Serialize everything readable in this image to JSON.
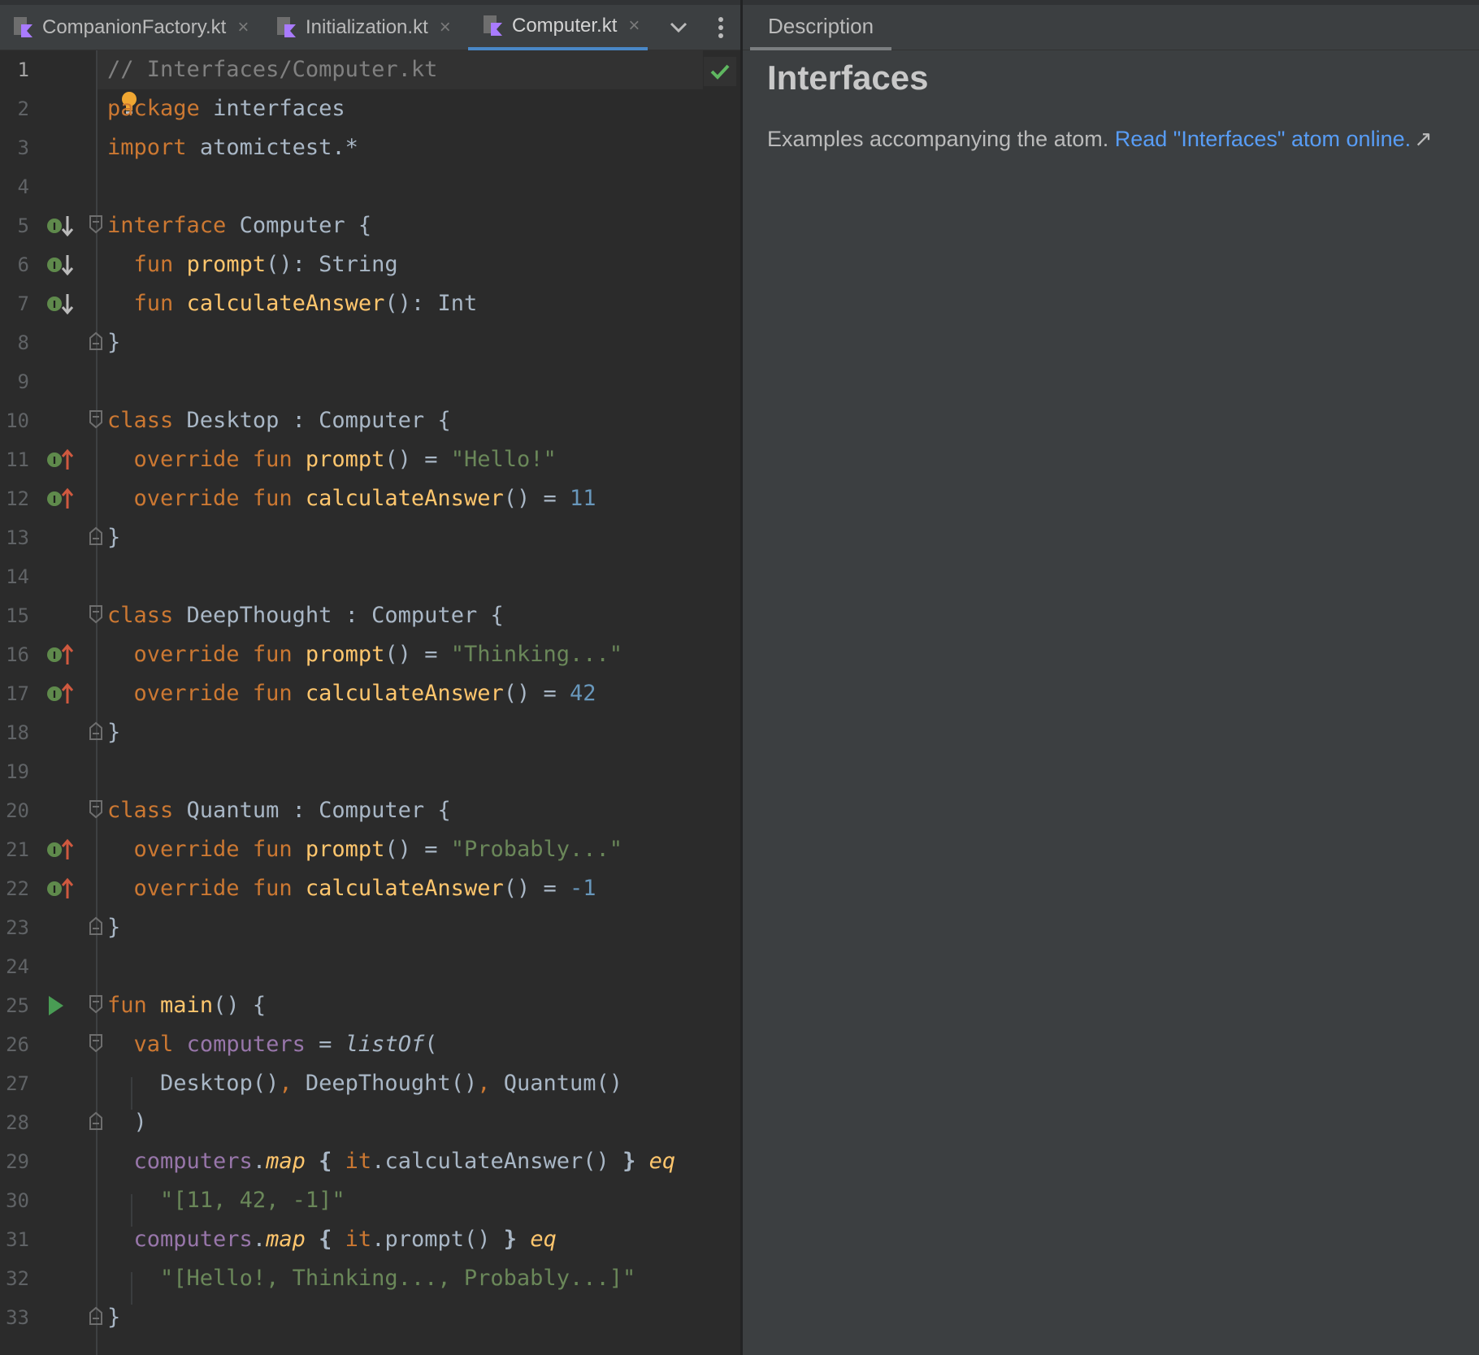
{
  "editor": {
    "tabs": [
      {
        "label": "CompanionFactory.kt",
        "close": "×"
      },
      {
        "label": "Initialization.kt",
        "close": "×"
      },
      {
        "label": "Computer.kt",
        "close": "×"
      }
    ],
    "line_numbers": [
      "1",
      "2",
      "3",
      "4",
      "5",
      "6",
      "7",
      "8",
      "9",
      "10",
      "11",
      "12",
      "13",
      "14",
      "15",
      "16",
      "17",
      "18",
      "19",
      "20",
      "21",
      "22",
      "23",
      "24",
      "25",
      "26",
      "27",
      "28",
      "29",
      "30",
      "31",
      "32",
      "33"
    ],
    "code": {
      "comment": "// Interfaces/Computer.kt",
      "kw_package": "package",
      "pkg_name": "interfaces",
      "kw_import": "import",
      "import_name": "atomictest.*",
      "kw_interface": "interface",
      "computer": "Computer",
      "brace_open": "{",
      "brace_close": "}",
      "kw_fun": "fun",
      "prompt": "prompt",
      "calculate_answer": "calculateAnswer",
      "parens_colon": "():",
      "parens": "()",
      "type_string": "String",
      "type_int": "Int",
      "kw_class": "class",
      "desktop": "Desktop",
      "deep_thought": "DeepThought",
      "quantum": "Quantum",
      "colon": ":",
      "equals": "=",
      "kw_override": "override",
      "str_hello": "\"Hello!\"",
      "num_11": "11",
      "str_thinking": "\"Thinking...\"",
      "num_42": "42",
      "str_probably": "\"Probably...\"",
      "num_neg1": "-1",
      "main": "main",
      "kw_val": "val",
      "computers": "computers",
      "list_of": "listOf",
      "paren_open": "(",
      "paren_close": ")",
      "comma": ",",
      "dot": ".",
      "map": "map",
      "it": "it",
      "eq": "eq",
      "str_answers": "\"[11, 42, -1]\"",
      "str_prompts": "\"[Hello!, Thinking..., Probably...]\""
    }
  },
  "description": {
    "tab_label": "Description",
    "title": "Interfaces",
    "text": "Examples accompanying the atom.",
    "link": "Read \"Interfaces\" atom online.",
    "link_arrow": "↗"
  },
  "colors": {
    "editor_bg": "#2b2b2b",
    "panel_bg": "#3c3f41",
    "accent_tab": "#4a88c7",
    "keyword": "#cc7832",
    "function": "#ffc66d",
    "string": "#6a8759",
    "number": "#6897bb",
    "comment": "#808080",
    "property": "#9876aa",
    "link": "#589df6",
    "success": "#5fb760"
  }
}
